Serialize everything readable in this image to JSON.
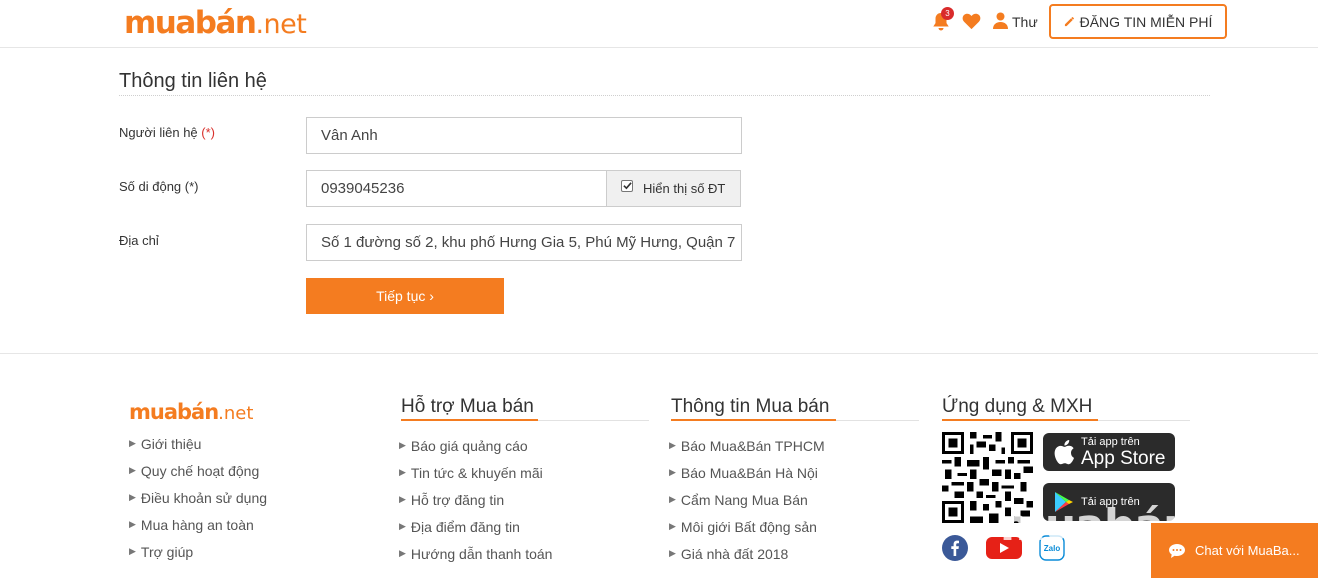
{
  "header": {
    "logo_main": "muabán",
    "logo_tld": ".net",
    "notification_count": "3",
    "user_name": "Thư",
    "post_button_label": "ĐĂNG TIN MIỄN PHÍ"
  },
  "form": {
    "section_title": "Thông tin liên hệ",
    "contact_label": "Người liên hệ",
    "contact_required": "(*)",
    "contact_value": "Vân Anh",
    "phone_label": "Số di động",
    "phone_required": "(*)",
    "phone_value": "0939045236",
    "show_phone_label": "Hiển thị số ĐT",
    "show_phone_checked": true,
    "address_label": "Địa chỉ",
    "address_value": "Số 1 đường số 2, khu phố Hưng Gia 5, Phú Mỹ Hưng, Quận 7",
    "continue_label": "Tiếp tục ›"
  },
  "footer": {
    "logo_main": "muabán",
    "logo_tld": ".net",
    "about_links": [
      "Giới thiệu",
      "Quy chế hoạt động",
      "Điều khoản sử dụng",
      "Mua hàng an toàn",
      "Trợ giúp"
    ],
    "support": {
      "title": "Hỗ trợ Mua bán",
      "links": [
        "Báo giá quảng cáo",
        "Tin tức & khuyến mãi",
        "Hỗ trợ đăng tin",
        "Địa điểm đăng tin",
        "Hướng dẫn thanh toán"
      ]
    },
    "info": {
      "title": "Thông tin Mua bán",
      "links": [
        "Báo Mua&Bán TPHCM",
        "Báo Mua&Bán Hà Nội",
        "Cẩm Nang Mua Bán",
        "Môi giới Bất động sản",
        "Giá nhà đất 2018"
      ]
    },
    "apps": {
      "title": "Ứng dụng & MXH",
      "app_store_small": "Tải app trên",
      "app_store_large": "App Store",
      "play_store_small": "Tải app trên",
      "social_icons": [
        "facebook-icon",
        "youtube-icon",
        "zalo-icon"
      ],
      "zalo_text": "Zalo"
    },
    "watermark": "muabán.net",
    "chat_label": "Chat với MuaBa..."
  },
  "colors": {
    "brand_orange": "#f47c20",
    "badge_red": "#d92b2b"
  }
}
